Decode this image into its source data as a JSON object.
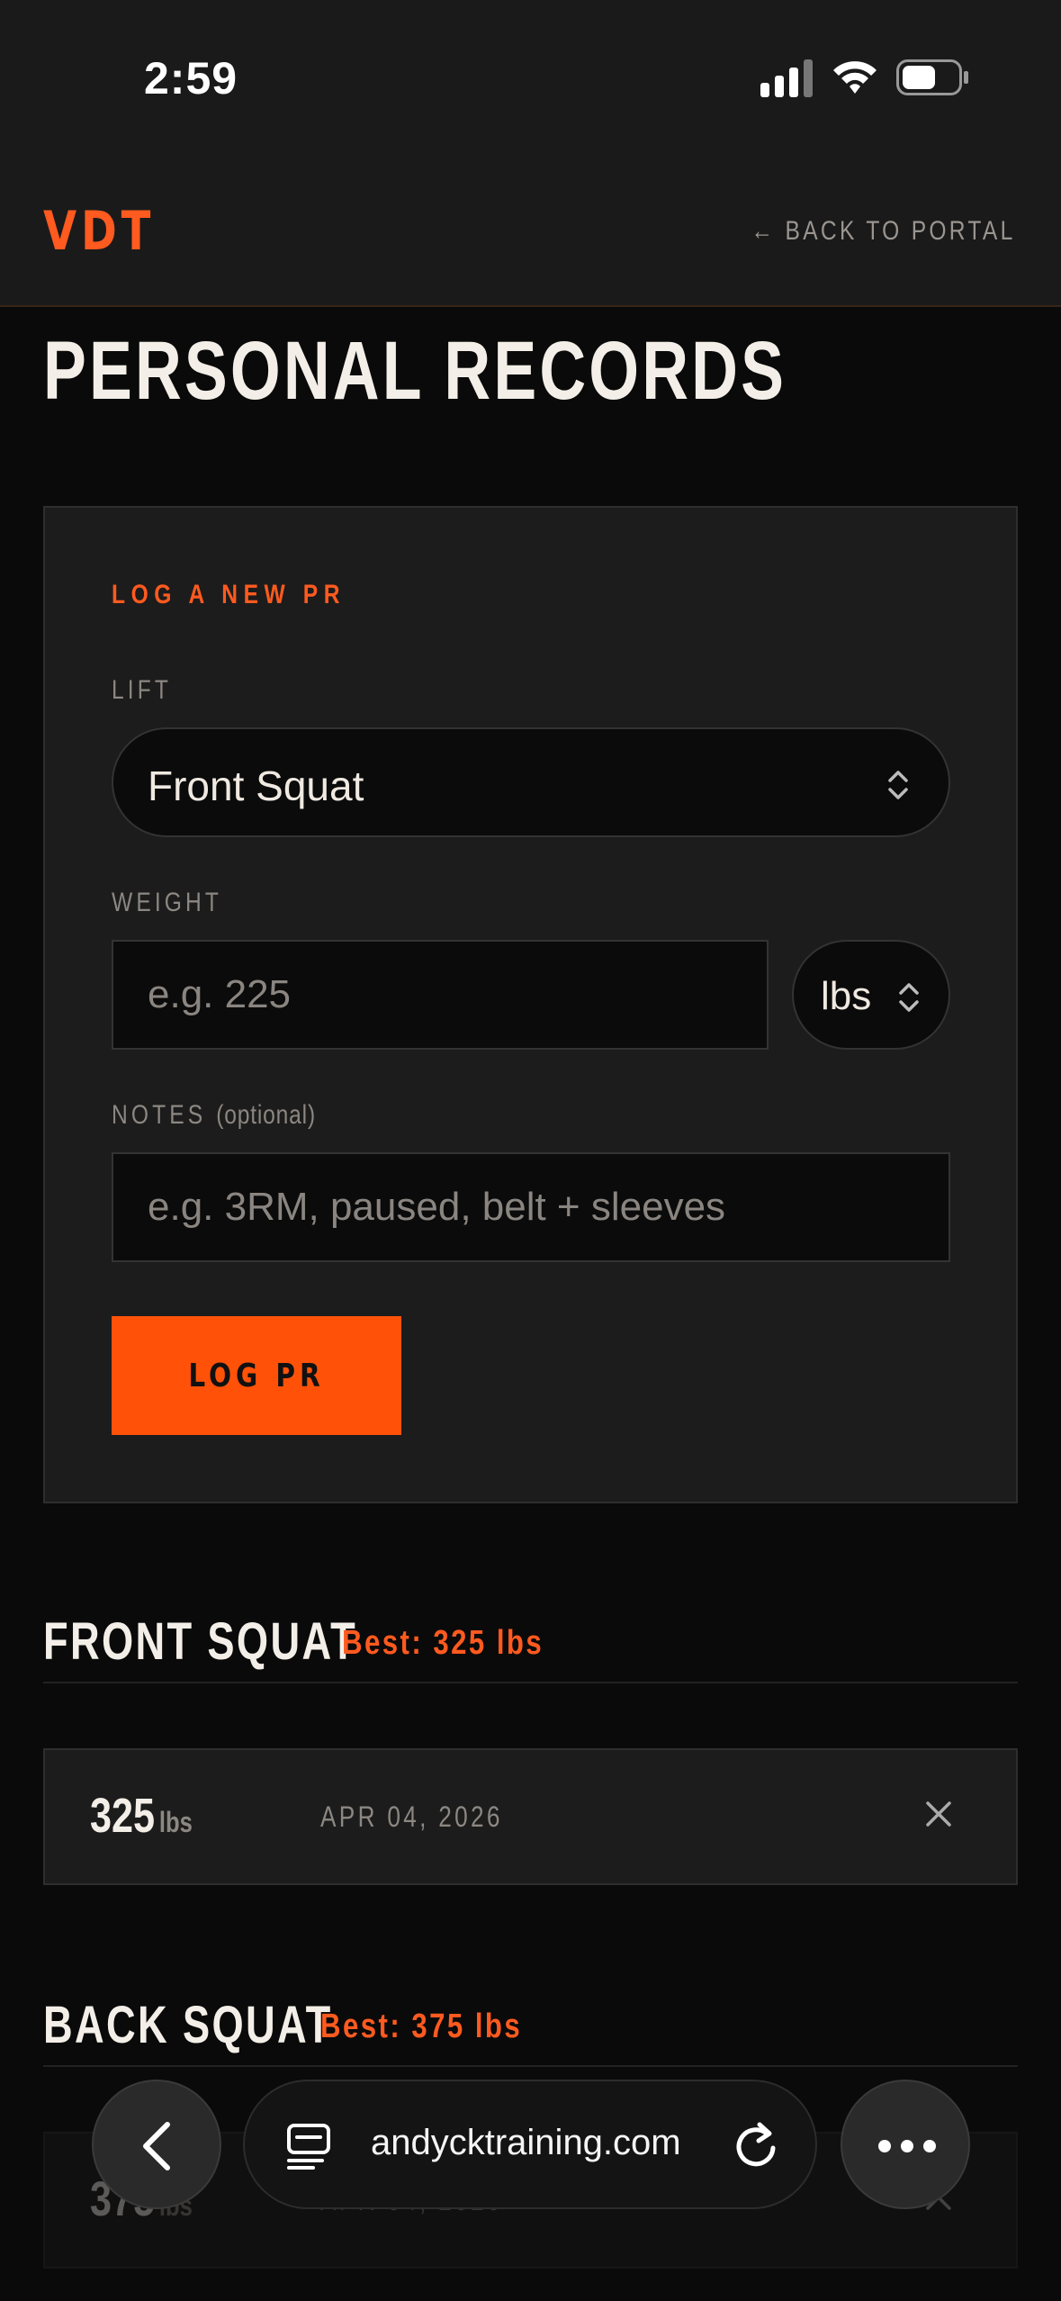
{
  "status_bar": {
    "time": "2:59"
  },
  "header": {
    "brand": "VDT",
    "back_link": "← BACK TO PORTAL"
  },
  "page_title": "PERSONAL RECORDS",
  "form": {
    "heading": "LOG A NEW PR",
    "lift_label": "LIFT",
    "lift_value": "Front Squat",
    "weight_label": "WEIGHT",
    "weight_placeholder": "e.g. 225",
    "unit_value": "lbs",
    "notes_label": "NOTES",
    "notes_optional": "(optional)",
    "notes_placeholder": "e.g. 3RM, paused, belt + sleeves",
    "submit_label": "LOG PR"
  },
  "lifts": [
    {
      "name": "FRONT SQUAT",
      "best": "Best: 325 lbs",
      "records": [
        {
          "value": "325",
          "unit": "lbs",
          "date": "APR 04, 2026"
        }
      ]
    },
    {
      "name": "BACK SQUAT",
      "best": "Best: 375 lbs",
      "records": [
        {
          "value": "375",
          "unit": "lbs",
          "date": "APR 04, 2026"
        }
      ]
    }
  ],
  "browser": {
    "url": "andycktraining.com"
  },
  "colors": {
    "accent": "#ff5a1f",
    "background": "#0a0a0a",
    "card": "#1c1c1c"
  }
}
